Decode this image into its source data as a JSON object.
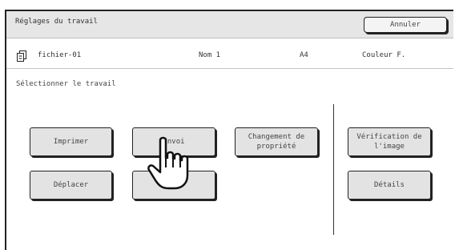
{
  "header": {
    "title": "Réglages du travail",
    "cancel_label": "Annuler"
  },
  "job_info": {
    "icon": "file-icon",
    "file_name": "fichier-01",
    "user": "Nom 1",
    "paper": "A4",
    "color_mode": "Couleur F."
  },
  "prompt": "Sélectionner le travail",
  "buttons": {
    "print": "Imprimer",
    "send": "Envoi",
    "change_property": "Changement de\npropriété",
    "image_check": "Vérification de\nl'image",
    "move": "Déplacer",
    "blank": "",
    "details": "Détails"
  },
  "cursor": "pointing-hand-icon"
}
